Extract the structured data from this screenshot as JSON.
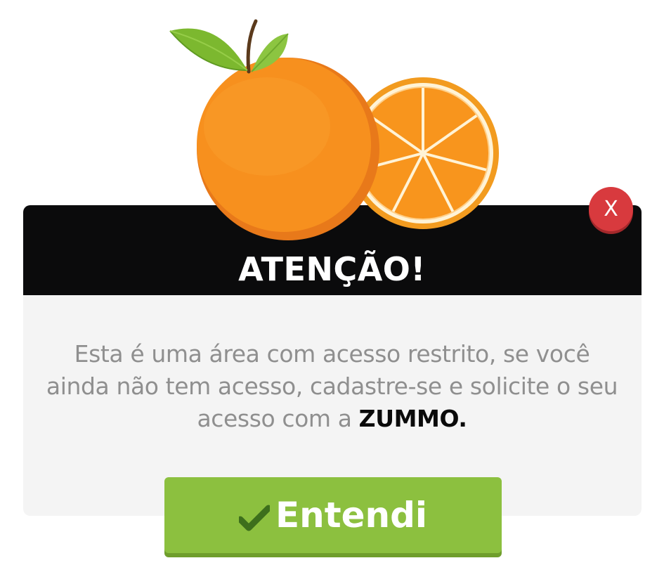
{
  "dialog": {
    "title": "ATENÇÃO!",
    "message_text": "Esta é uma área com acesso restrito, se você ainda não tem acesso, cadastre-se e solicite o seu acesso com a ",
    "brand_name": "ZUMMO.",
    "close_label": "X",
    "confirm_label": "Entendi",
    "confirm_icon": "check-icon",
    "illustration": "orange-fruit-illustration"
  },
  "colors": {
    "header": "#0b0b0c",
    "body": "#f4f4f4",
    "close": "#d83a3e",
    "confirm": "#8cc03f",
    "orange": "#f7901e",
    "leaf": "#7cb82f"
  }
}
